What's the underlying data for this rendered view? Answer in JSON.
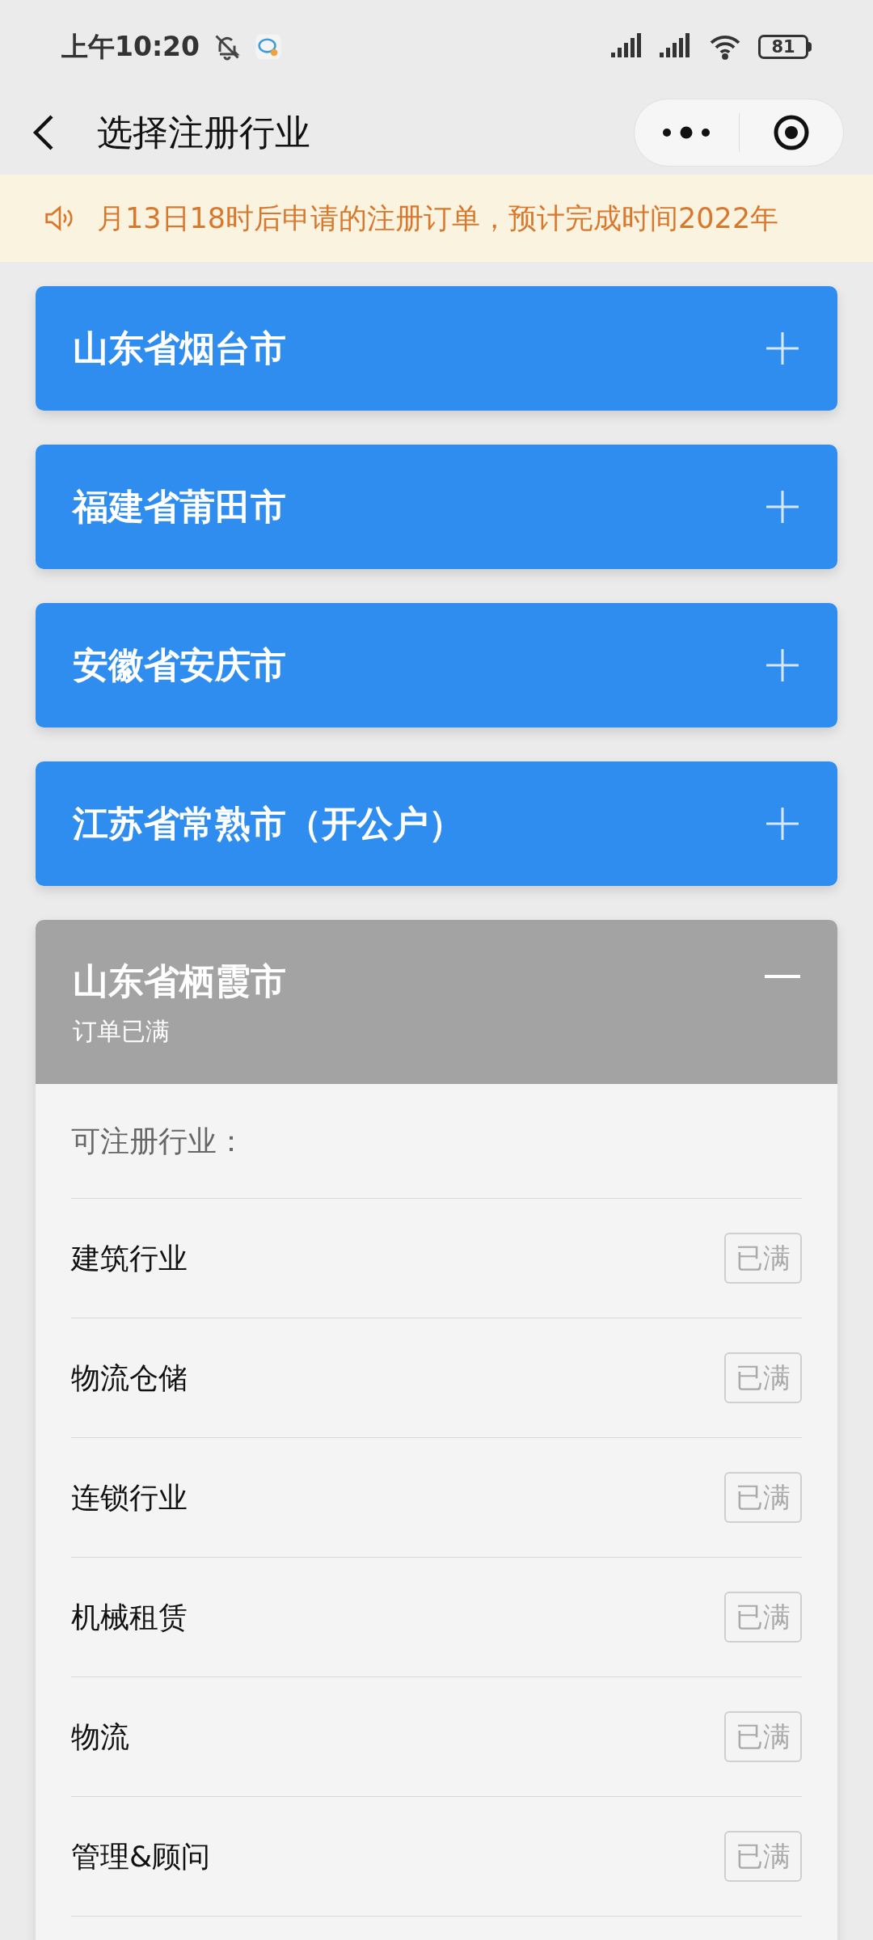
{
  "status_bar": {
    "time": "上午10:20",
    "battery": "81"
  },
  "nav": {
    "title": "选择注册行业"
  },
  "notice": {
    "text": "月13日18时后申请的注册订单，预计完成时间2022年"
  },
  "regions": [
    {
      "name": "山东省烟台市",
      "full": false,
      "expanded": false
    },
    {
      "name": "福建省莆田市",
      "full": false,
      "expanded": false
    },
    {
      "name": "安徽省安庆市",
      "full": false,
      "expanded": false
    },
    {
      "name": "江苏省常熟市（开公户）",
      "full": false,
      "expanded": false
    },
    {
      "name": "山东省栖霞市",
      "full": true,
      "expanded": true,
      "subtitle": "订单已满",
      "section_label": "可注册行业：",
      "industries": [
        {
          "name": "建筑行业",
          "status": "已满"
        },
        {
          "name": "物流仓储",
          "status": "已满"
        },
        {
          "name": "连锁行业",
          "status": "已满"
        },
        {
          "name": "机械租赁",
          "status": "已满"
        },
        {
          "name": "物流",
          "status": "已满"
        },
        {
          "name": "管理&顾问",
          "status": "已满"
        }
      ]
    }
  ]
}
